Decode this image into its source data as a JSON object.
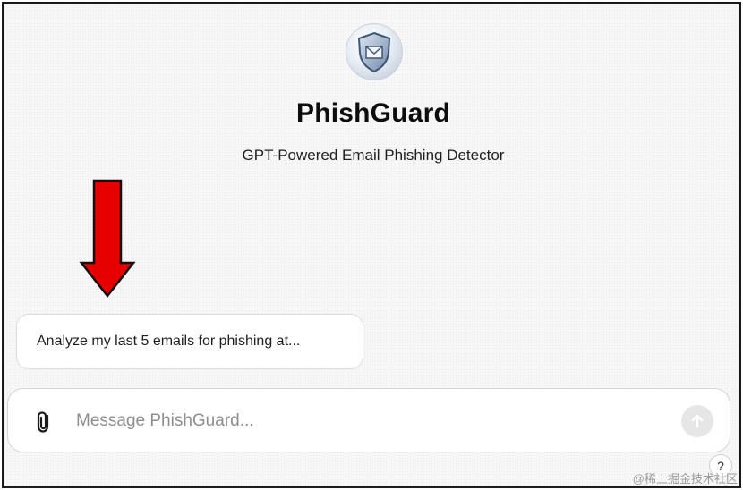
{
  "app": {
    "title": "PhishGuard",
    "subtitle": "GPT-Powered Email Phishing Detector",
    "logo_icon": "shield-envelope-icon"
  },
  "conversation_starters": [
    {
      "label": "Analyze my last 5 emails for phishing at..."
    }
  ],
  "composer": {
    "placeholder": "Message PhishGuard...",
    "value": "",
    "attach_icon": "paperclip-icon",
    "send_icon": "arrow-up-icon"
  },
  "help": {
    "label": "?"
  },
  "annotation": {
    "arrow_color": "#e60000"
  },
  "watermark": {
    "text": "@稀土掘金技术社区"
  }
}
